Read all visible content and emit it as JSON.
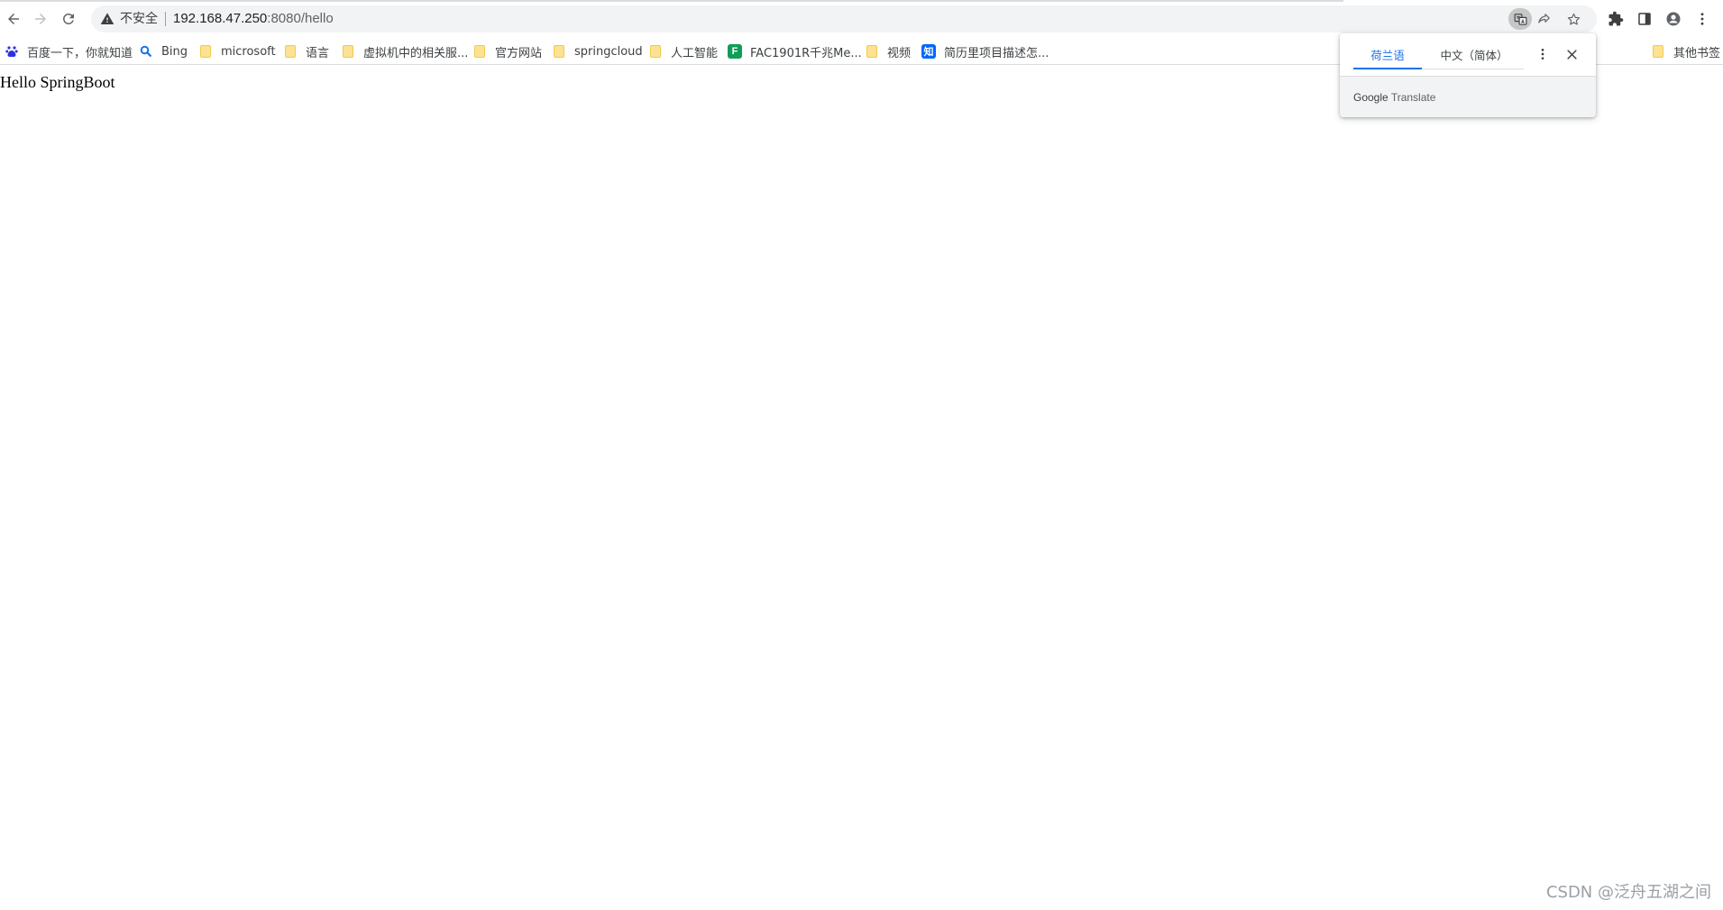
{
  "toolbar": {
    "security_label": "不安全",
    "url_host": "192.168.47.250",
    "url_rest": ":8080/hello"
  },
  "bookmarks": [
    {
      "label": "百度一下，你就知道",
      "icon": "baidu-paw-icon"
    },
    {
      "label": "Bing",
      "icon": "bing-search-icon"
    },
    {
      "label": "microsoft",
      "icon": "folder-icon"
    },
    {
      "label": "语言",
      "icon": "folder-icon"
    },
    {
      "label": "虚拟机中的相关服...",
      "icon": "folder-icon"
    },
    {
      "label": "官方网站",
      "icon": "folder-icon"
    },
    {
      "label": "springcloud",
      "icon": "folder-icon"
    },
    {
      "label": "人工智能",
      "icon": "folder-icon"
    },
    {
      "label": "FAC1901R千兆Me...",
      "icon": "green-f-favicon",
      "favicon_text": "F",
      "favicon_color": "#0f9d58"
    },
    {
      "label": "视频",
      "icon": "folder-icon"
    },
    {
      "label": "简历里项目描述怎...",
      "icon": "zhihu-favicon",
      "favicon_text": "知",
      "favicon_color": "#0066ff"
    }
  ],
  "other_bookmarks": "其他书签",
  "page": {
    "text": "Hello SpringBoot"
  },
  "translate_popup": {
    "source_tab": "荷兰语",
    "target_tab": "中文（简体）",
    "brand_google": "Google",
    "brand_translate": "Translate"
  },
  "watermark": "CSDN @泛舟五湖之间",
  "colors": {
    "accent": "#1a73e8",
    "folder": "#fde293",
    "omnibox": "#f1f3f4"
  }
}
